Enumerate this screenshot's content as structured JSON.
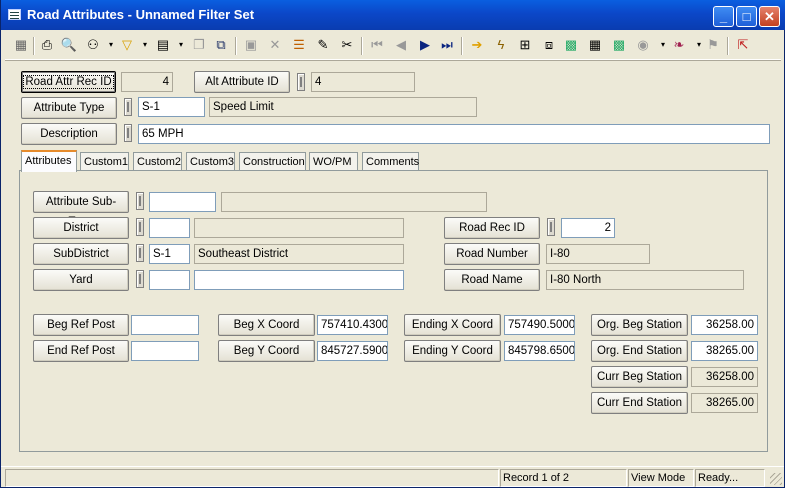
{
  "window": {
    "title": "Road Attributes - Unnamed Filter Set"
  },
  "toolbar": {
    "icons": [
      "grid-icon",
      "print-icon",
      "print-preview-icon",
      "binoculars-icon",
      "filter-icon",
      "view-icon",
      "copy-icon",
      "duplicate-icon",
      "save-icon",
      "delete-icon",
      "stack-icon",
      "pencil-icon",
      "scissors-icon",
      "first-icon",
      "prev-icon",
      "next-icon",
      "last-icon",
      "arrow-icon",
      "lightning-icon",
      "tree-icon",
      "hierarchy-icon",
      "map-icon",
      "calculator-icon",
      "map2-icon",
      "globe-icon",
      "book-icon",
      "flag-icon",
      "exit-icon"
    ]
  },
  "header": {
    "road_attr_rec_id_label": "Road Attr Rec ID",
    "road_attr_rec_id": "4",
    "alt_attribute_id_label": "Alt Attribute ID",
    "alt_attribute_id": "4",
    "attribute_type_label": "Attribute Type",
    "attribute_type_code": "S-1",
    "attribute_type_desc": "Speed Limit",
    "description_label": "Description",
    "description": "65 MPH"
  },
  "tabs": [
    "Attributes",
    "Custom1",
    "Custom2",
    "Custom3",
    "Construction",
    "WO/PM",
    "Comments"
  ],
  "attributes": {
    "sub_type_label": "Attribute Sub-Type",
    "sub_type_code": "",
    "sub_type_desc": "",
    "district_label": "District",
    "district_code": "",
    "district_desc": "",
    "subdistrict_label": "SubDistrict",
    "subdistrict_code": "S-1",
    "subdistrict_desc": "Southeast District",
    "yard_label": "Yard",
    "yard_code": "",
    "yard_desc": "",
    "road_rec_id_label": "Road Rec ID",
    "road_rec_id": "2",
    "road_number_label": "Road Number",
    "road_number": "I-80",
    "road_name_label": "Road Name",
    "road_name": "I-80 North",
    "beg_ref_post_label": "Beg Ref Post",
    "beg_ref_post": "",
    "end_ref_post_label": "End Ref Post",
    "end_ref_post": "",
    "beg_x_label": "Beg X Coord",
    "beg_x": "757410.4300",
    "beg_y_label": "Beg Y Coord",
    "beg_y": "845727.5900",
    "end_x_label": "Ending X Coord",
    "end_x": "757490.5000",
    "end_y_label": "Ending Y Coord",
    "end_y": "845798.6500",
    "org_beg_label": "Org. Beg Station",
    "org_beg": "36258.00",
    "org_end_label": "Org. End Station",
    "org_end": "38265.00",
    "curr_beg_label": "Curr Beg Station",
    "curr_beg": "36258.00",
    "curr_end_label": "Curr End Station",
    "curr_end": "38265.00"
  },
  "status": {
    "record": "Record 1 of 2",
    "mode": "View Mode",
    "state": "Ready..."
  }
}
